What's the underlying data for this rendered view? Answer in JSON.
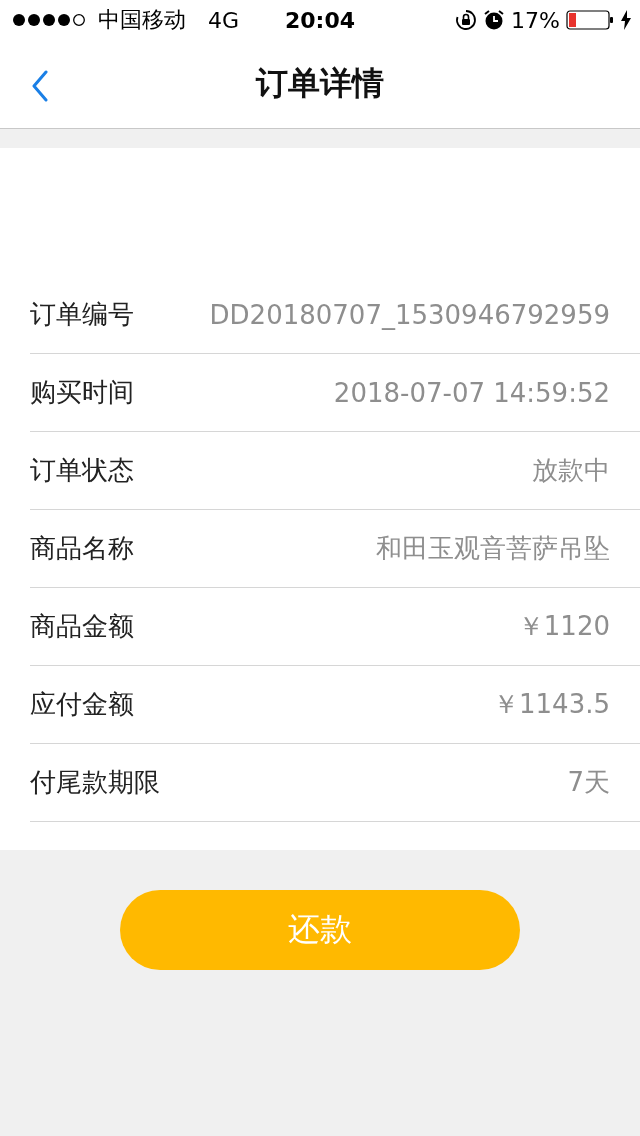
{
  "status_bar": {
    "carrier": "中国移动",
    "network": "4G",
    "time": "20:04",
    "battery": "17%"
  },
  "nav": {
    "title": "订单详情"
  },
  "details": [
    {
      "label": "订单编号",
      "value": "DD20180707_1530946792959"
    },
    {
      "label": "购买时间",
      "value": "2018-07-07 14:59:52"
    },
    {
      "label": "订单状态",
      "value": "放款中"
    },
    {
      "label": "商品名称",
      "value": "和田玉观音菩萨吊坠"
    },
    {
      "label": "商品金额",
      "value": "￥1120"
    },
    {
      "label": "应付金额",
      "value": "￥1143.5"
    },
    {
      "label": "付尾款期限",
      "value": "7天"
    }
  ],
  "action_button": "还款"
}
